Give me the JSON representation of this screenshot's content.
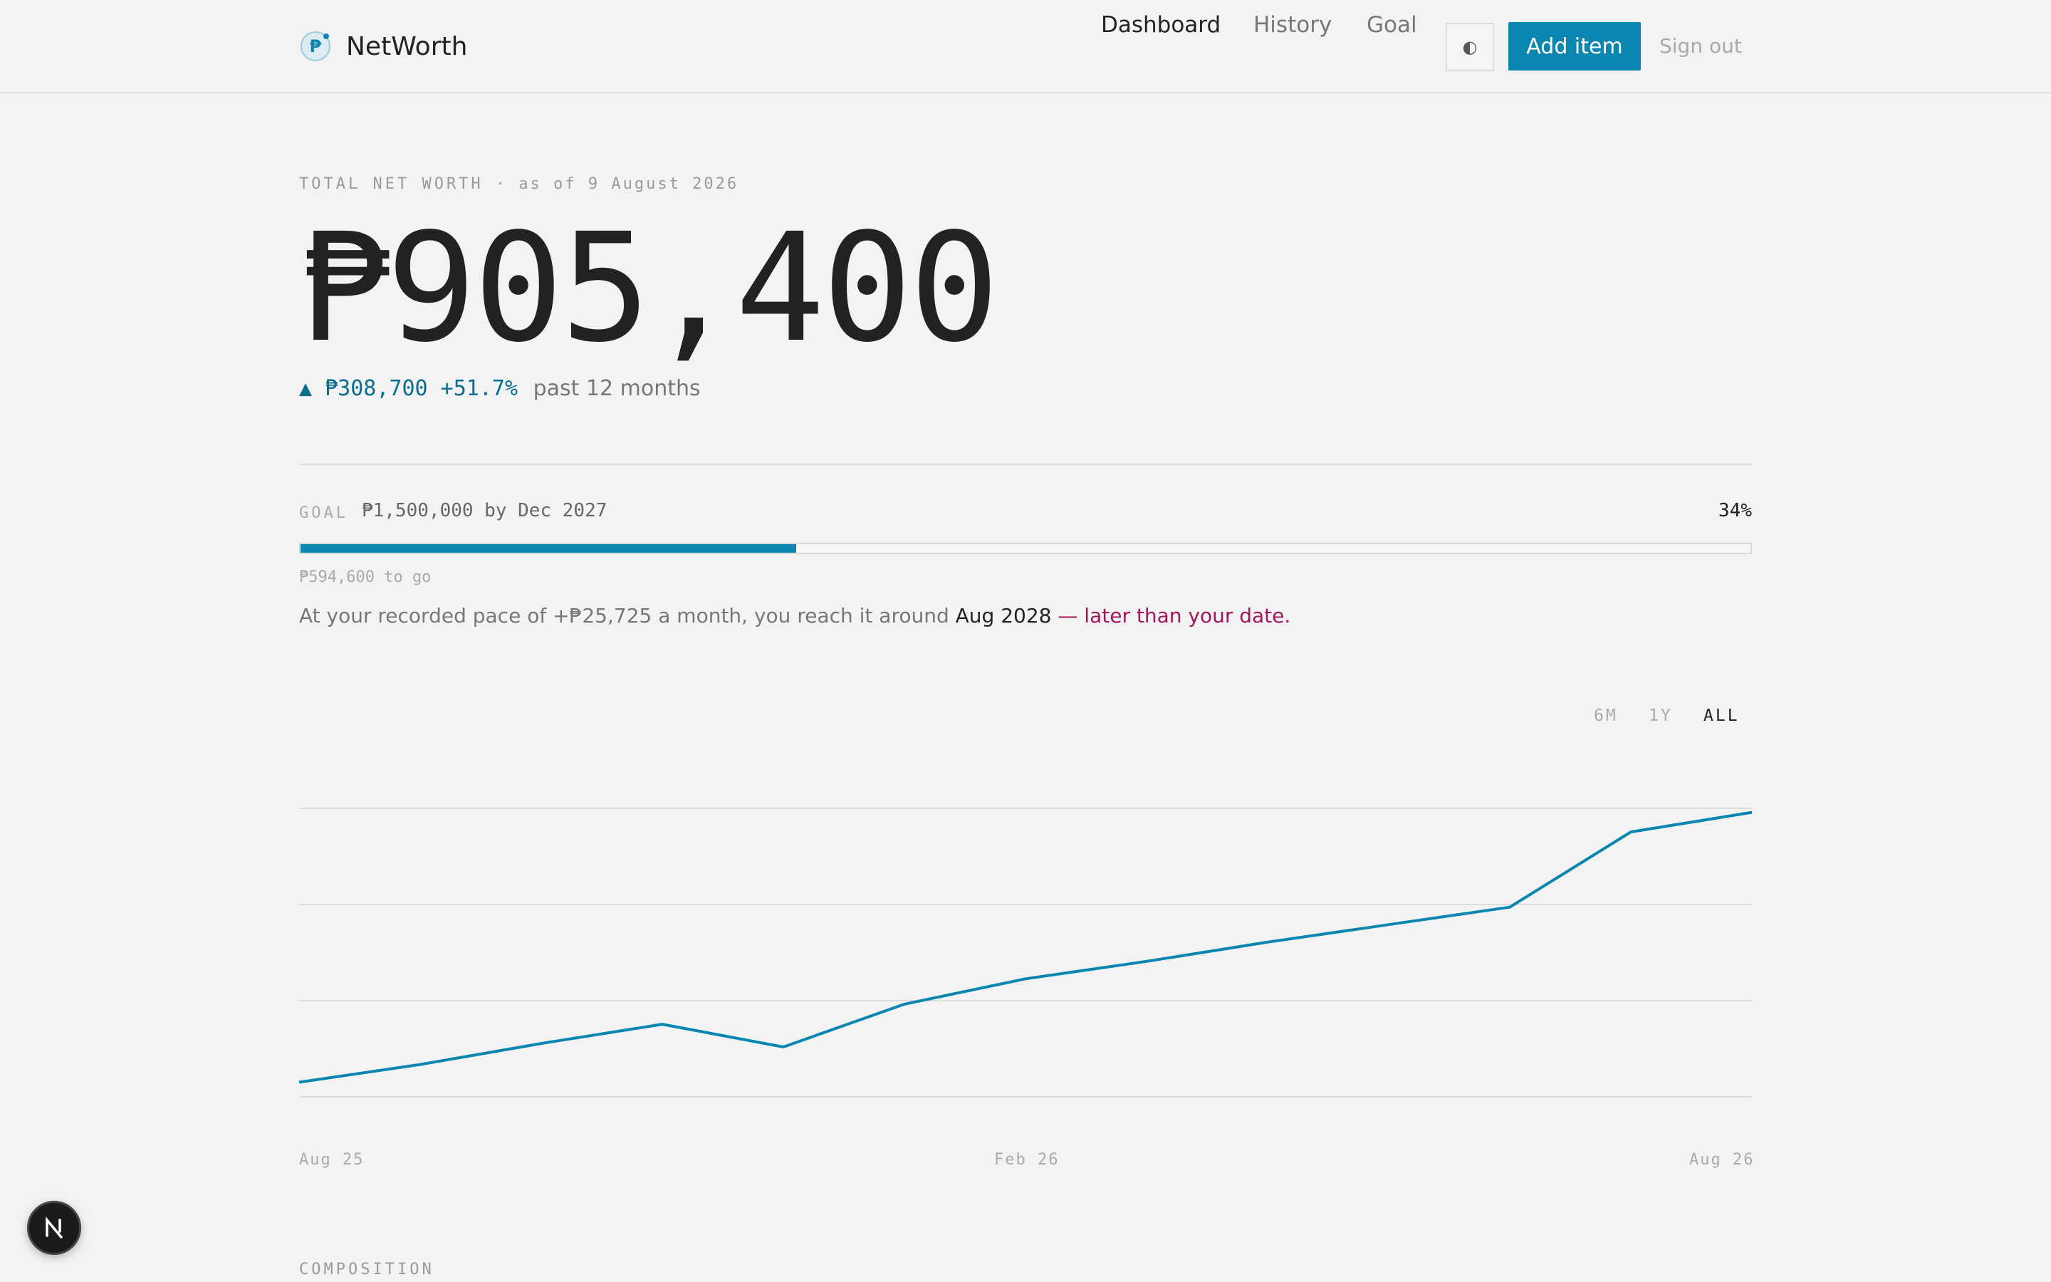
{
  "header": {
    "brand": "NetWorth",
    "nav": [
      "Dashboard",
      "History",
      "Goal"
    ],
    "active_nav": "Dashboard",
    "theme_toggle_glyph": "◐",
    "add_item_label": "Add item",
    "sign_out_label": "Sign out"
  },
  "summary": {
    "label": "TOTAL NET WORTH",
    "as_of": "· as of 9 August 2026",
    "value": "₱905,400",
    "change_amount": "▲ ₱308,700 +51.7%",
    "change_period": "past 12 months"
  },
  "goal": {
    "label": "GOAL",
    "target": "₱1,500,000 by Dec 2027",
    "percent_label": "34%",
    "progress_fraction": 0.342,
    "remaining": "₱594,600 to go",
    "pace_prefix": "At your recorded pace of +₱25,725 a month, you reach it around",
    "pace_date": "Aug 2028",
    "pace_warning": "— later than your date."
  },
  "range_tabs": [
    "6M",
    "1Y",
    "ALL"
  ],
  "active_range": "ALL",
  "chart_data": {
    "type": "line",
    "x": [
      "Aug 25",
      "Sep 25",
      "Oct 25",
      "Nov 25",
      "Dec 25",
      "Jan 26",
      "Feb 26",
      "Mar 26",
      "Apr 26",
      "May 26",
      "Jun 26",
      "Jul 26",
      "Aug 26"
    ],
    "series": [
      {
        "values": [
          596700,
          617000,
          641000,
          663000,
          637000,
          686000,
          715000,
          735000,
          757000,
          777000,
          797000,
          883000,
          905400
        ]
      }
    ],
    "x_tick_labels": [
      "Aug 25",
      "Feb 26",
      "Aug 26"
    ],
    "ylim": [
      580000,
      910000
    ],
    "grid": true,
    "legend": "none"
  },
  "composition": {
    "label": "COMPOSITION"
  },
  "colors": {
    "accent": "#0a86b0",
    "positive": "#0a6e8e",
    "warning": "#a0185a",
    "background": "#f3f3f3"
  }
}
